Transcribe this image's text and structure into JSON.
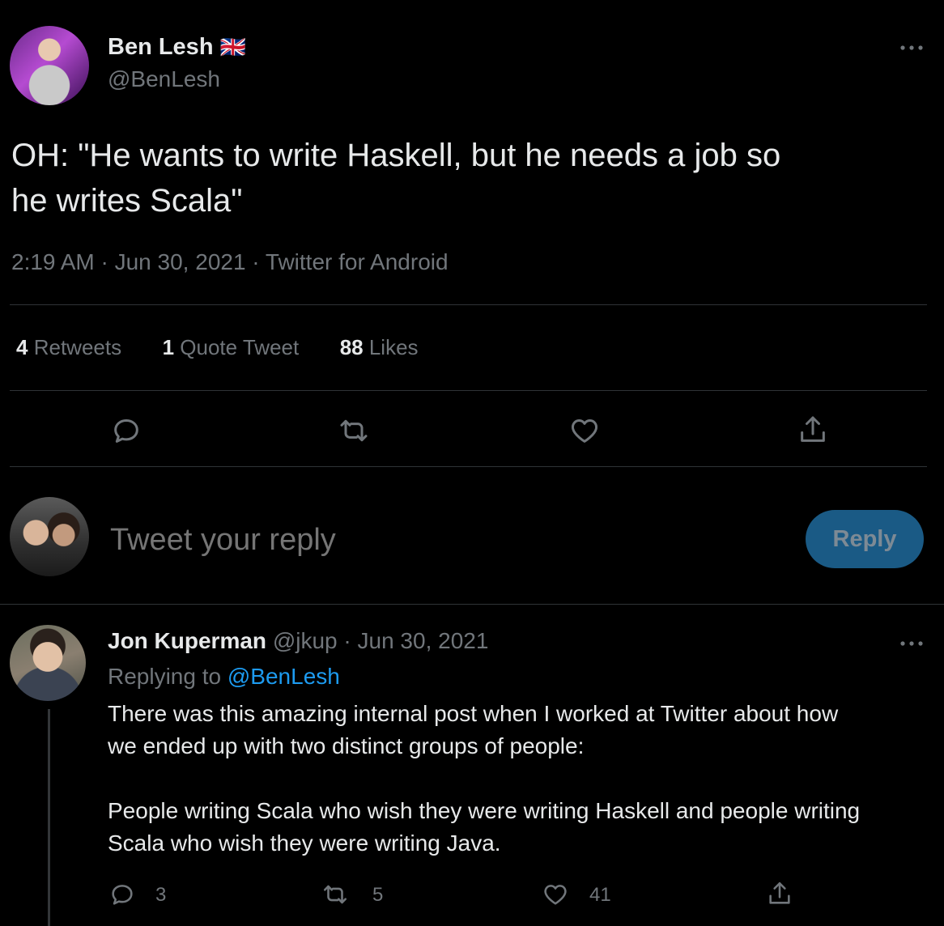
{
  "tweet": {
    "author_name": "Ben Lesh",
    "author_flag": "🇬🇧",
    "author_handle": "@BenLesh",
    "text_line1": "OH: \"He wants to write Haskell, but he needs a job so",
    "text_line2": "he writes Scala\"",
    "meta": "2:19 AM · Jun 30, 2021 · Twitter for Android",
    "stats": {
      "retweets_count": "4",
      "retweets_label": "Retweets",
      "quotes_count": "1",
      "quotes_label": "Quote Tweet",
      "likes_count": "88",
      "likes_label": "Likes"
    }
  },
  "composer": {
    "placeholder": "Tweet your reply",
    "button_label": "Reply"
  },
  "reply": {
    "author_name": "Jon Kuperman",
    "author_handle": "@jkup",
    "date": "· Jun 30, 2021",
    "replying_prefix": "Replying to",
    "replying_to": "@BenLesh",
    "line1": "There was this amazing internal post when I worked at Twitter about how",
    "line2": "we ended up with two distinct groups of people:",
    "line3": "People writing Scala who wish they were writing Haskell and people writing",
    "line4": "Scala who wish they were writing Java.",
    "reply_count": "3",
    "retweet_count": "5",
    "like_count": "41"
  },
  "colors": {
    "background": "#000000",
    "text": "#e7e9ea",
    "muted": "#71767b",
    "link": "#1d9bf0",
    "button": "#1a5a85"
  }
}
